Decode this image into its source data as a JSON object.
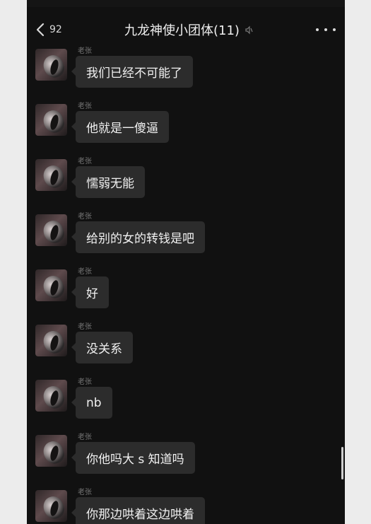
{
  "header": {
    "back_badge": "92",
    "title": "九龙神使小团体(11)",
    "mute_icon": "mute-icon",
    "more_icon": "more-icon"
  },
  "messages": [
    {
      "sender": "老张",
      "text": "我们已经不可能了"
    },
    {
      "sender": "老张",
      "text": "他就是一傻逼"
    },
    {
      "sender": "老张",
      "text": "懦弱无能"
    },
    {
      "sender": "老张",
      "text": "给别的女的转钱是吧"
    },
    {
      "sender": "老张",
      "text": "好"
    },
    {
      "sender": "老张",
      "text": "没关系"
    },
    {
      "sender": "老张",
      "text": "nb"
    },
    {
      "sender": "老张",
      "text": "你他吗大 s 知道吗"
    },
    {
      "sender": "老张",
      "text": "你那边哄着这边哄着"
    }
  ],
  "colors": {
    "background": "#111111",
    "bubble": "#2c2c2c",
    "text": "#f1f1f1",
    "muted_text": "#747474"
  }
}
